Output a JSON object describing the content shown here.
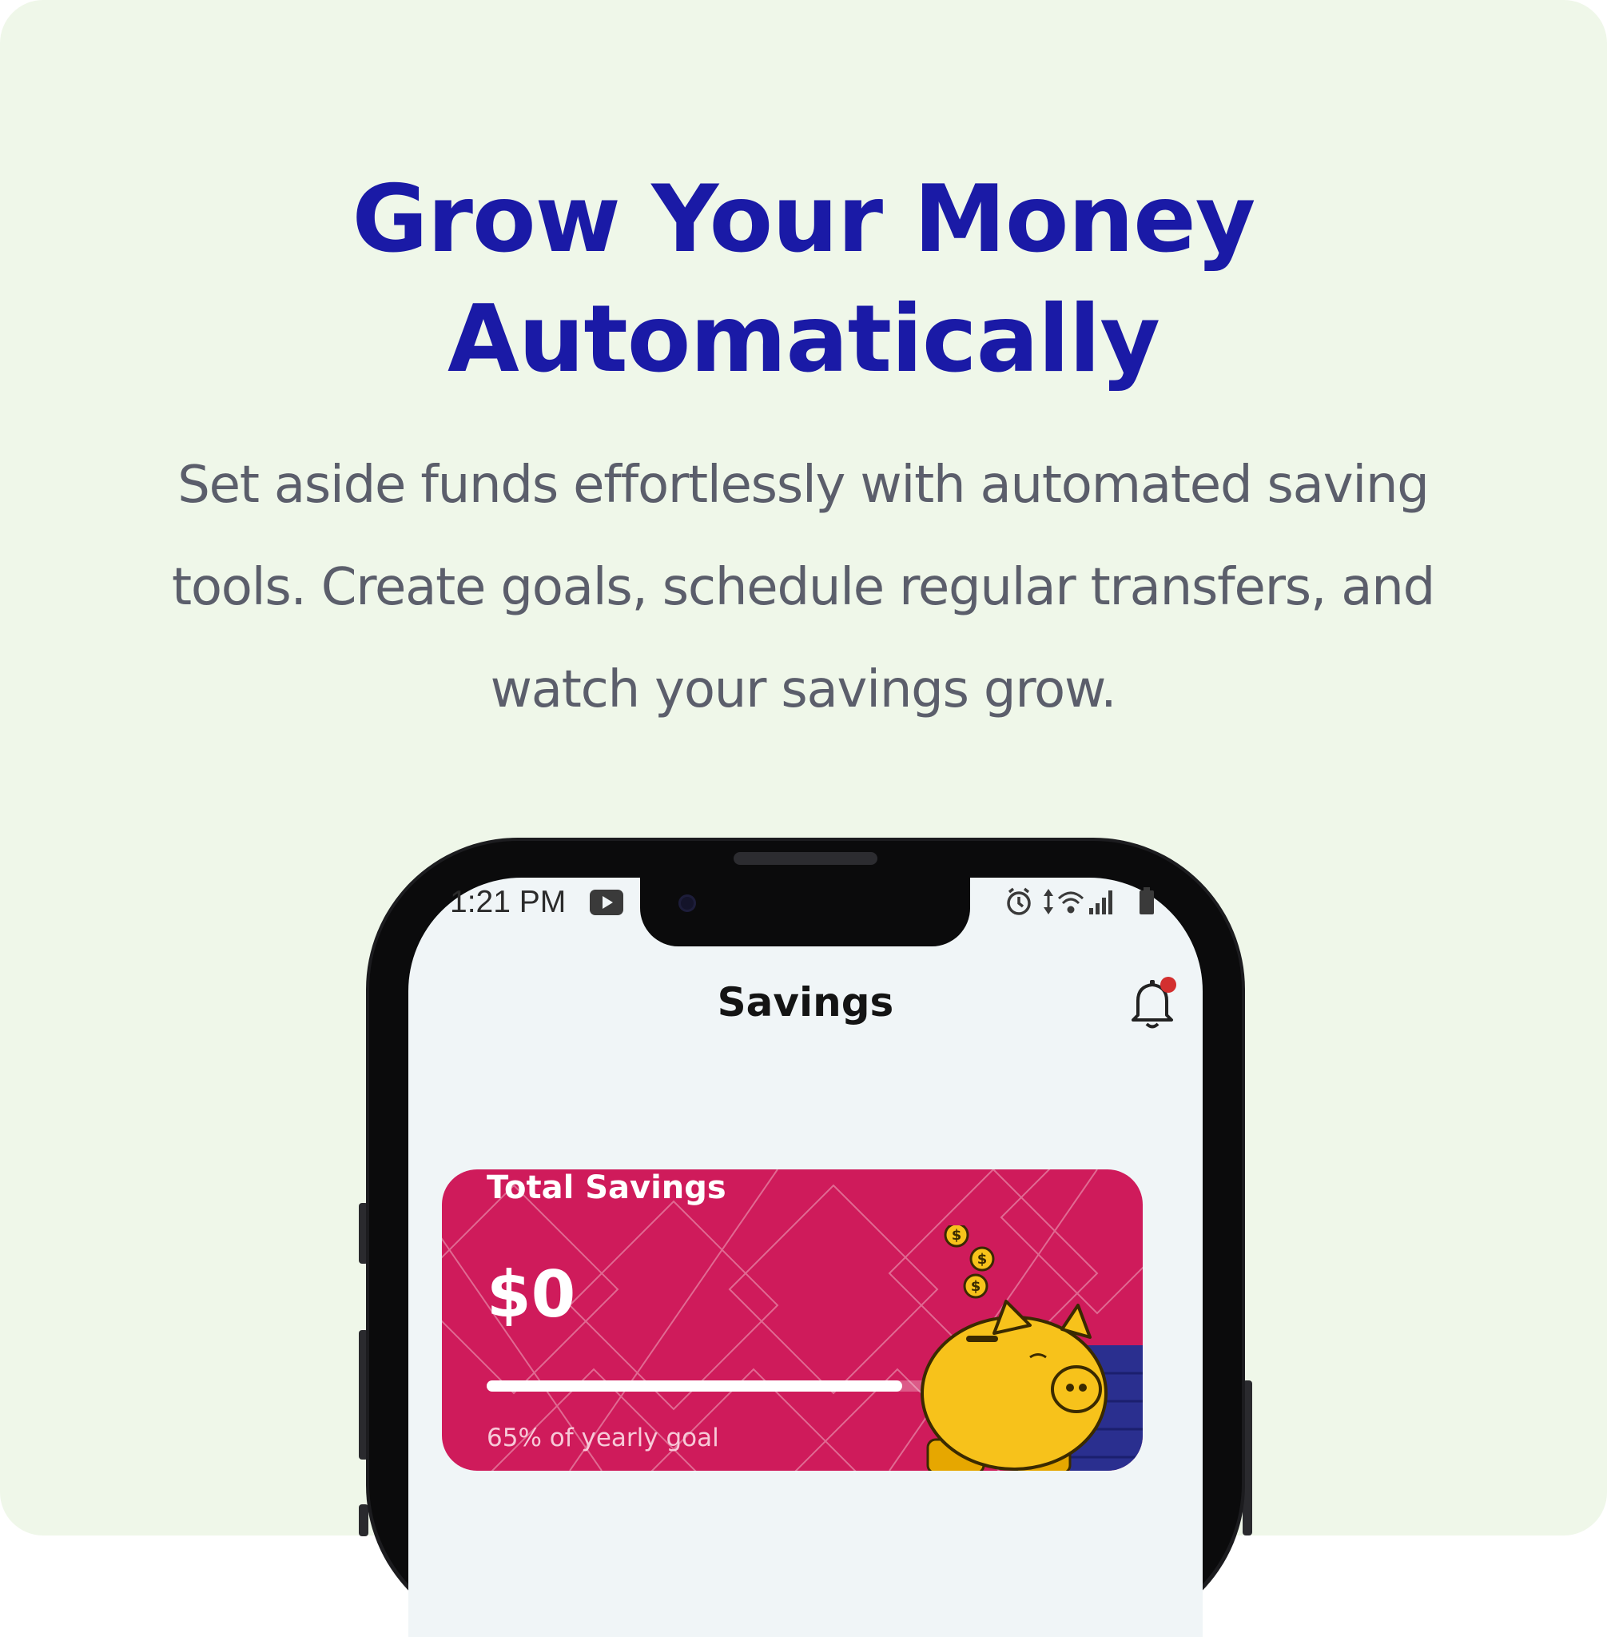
{
  "hero": {
    "headline_line1": "Grow Your Money",
    "headline_line2": "Automatically",
    "description": "Set aside funds effortlessly with automated saving tools. Create goals, schedule regular transfers, and watch your savings grow."
  },
  "phone": {
    "status_bar": {
      "time": "1:21 PM",
      "icons": [
        "youtube-icon",
        "alarm-icon",
        "data-arrows-icon",
        "wifi-icon",
        "signal-icon",
        "battery-icon"
      ]
    },
    "app": {
      "title": "Savings",
      "notification_badge": true,
      "savings_card": {
        "label": "Total Savings",
        "amount": "$0",
        "progress": 0.65,
        "goal_text": "65% of yearly goal"
      }
    }
  },
  "colors": {
    "background": "#eff7e9",
    "headline": "#1a1aa6",
    "body_text": "#5b5e6b",
    "card": "#cf1b5b",
    "badge": "#d32f2f",
    "piggy": "#f7c21b"
  }
}
